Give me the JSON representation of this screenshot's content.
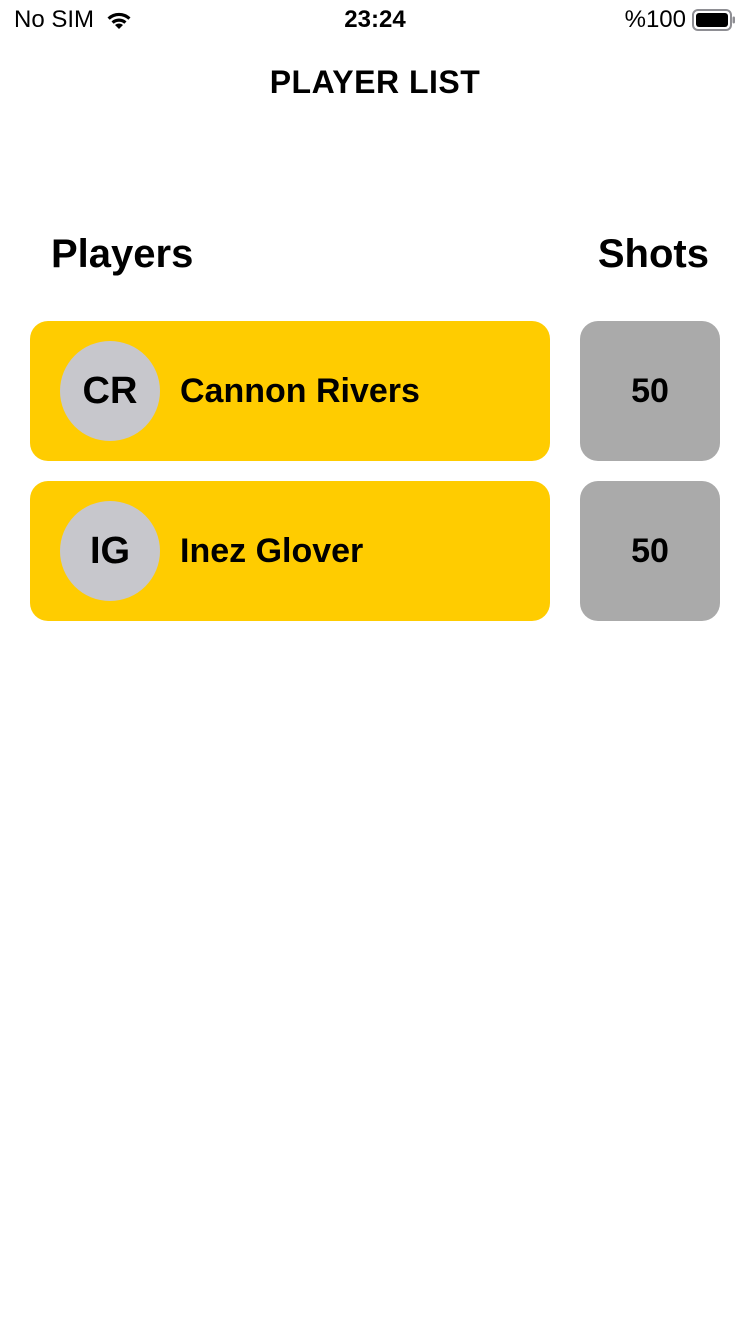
{
  "status_bar": {
    "carrier": "No SIM",
    "time": "23:24",
    "battery": "%100",
    "icons": [
      "wifi-icon",
      "battery-icon"
    ]
  },
  "nav": {
    "title": "PLAYER LIST"
  },
  "columns": {
    "players": "Players",
    "shots": "Shots"
  },
  "players": [
    {
      "initials": "CR",
      "name": "Cannon Rivers",
      "shots": "50"
    },
    {
      "initials": "IG",
      "name": "Inez Glover",
      "shots": "50"
    }
  ],
  "colors": {
    "card_accent": "#FFCC00",
    "avatar_bg": "#C7C7CC",
    "shots_bg": "#AAAAAA"
  }
}
